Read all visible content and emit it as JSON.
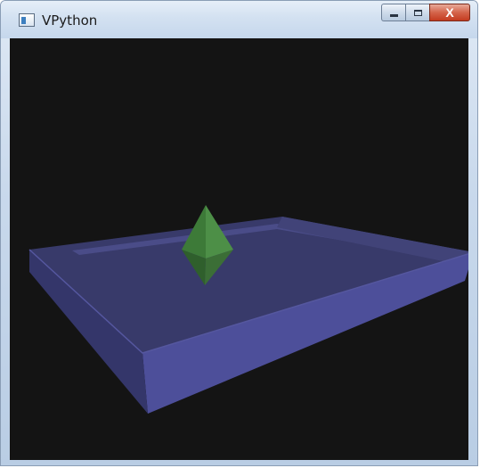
{
  "window": {
    "title": "VPython",
    "icon": "app-window-icon"
  },
  "caption_buttons": {
    "minimize_icon": "minimize-icon",
    "maximize_icon": "maximize-icon",
    "close_icon": "close-icon",
    "close_glyph": "X"
  },
  "scene": {
    "background_color": "#141414",
    "box_color": "#4d4f9a",
    "octahedron_color": "#3f7a3a"
  }
}
